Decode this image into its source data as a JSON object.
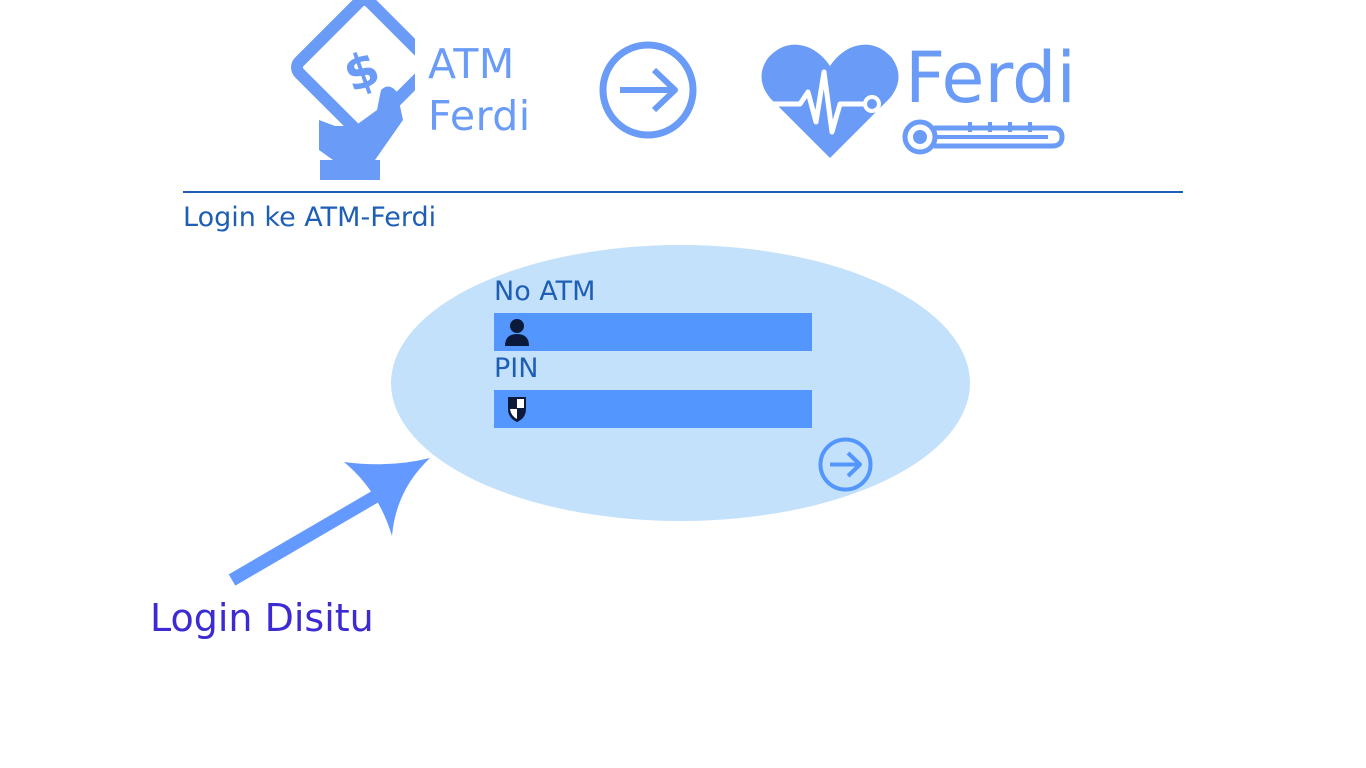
{
  "header": {
    "atm_logo_line1": "ATM",
    "atm_logo_line2": "Ferdi",
    "health_logo_text": "Ferdi"
  },
  "page_title": "Login ke ATM-Ferdi",
  "login_form": {
    "atm_label": "No ATM",
    "atm_value": "",
    "pin_label": "PIN",
    "pin_value": "",
    "user_icon": "user-icon",
    "shield_icon": "shield-icon",
    "submit_icon": "arrow-right-circle-icon"
  },
  "annotation": {
    "text": "Login Disitu"
  },
  "colors": {
    "logo_blue": "#6a9bf7",
    "title_blue": "#1e5fb5",
    "ellipse_bg": "#c4e1fb",
    "field_bg": "#5397fe",
    "annotation_text": "#3c2bd2",
    "annotation_arrow": "#6499ff"
  }
}
